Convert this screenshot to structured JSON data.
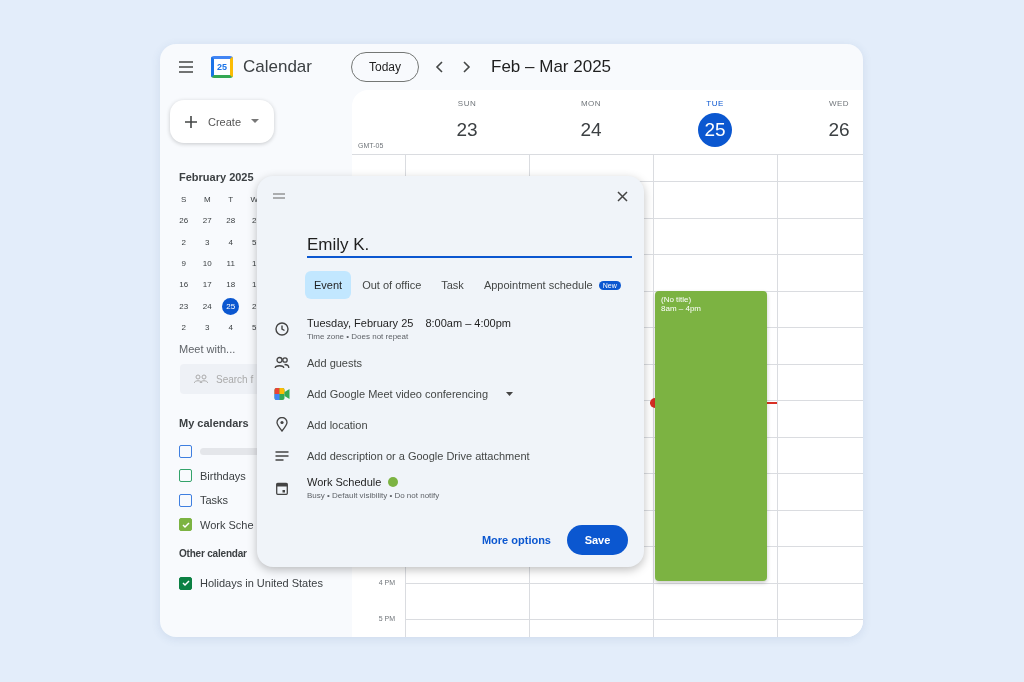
{
  "header": {
    "logo_text": "25",
    "app_name": "Calendar",
    "today_button": "Today",
    "date_range": "Feb – Mar 2025"
  },
  "sidebar": {
    "create_button": "Create",
    "mini_calendar": {
      "title": "February 2025",
      "weekdays": [
        "S",
        "M",
        "T",
        "W"
      ],
      "weeks": [
        [
          {
            "day": "26",
            "selected": false
          },
          {
            "day": "27",
            "selected": false
          },
          {
            "day": "28",
            "selected": false
          },
          {
            "day": "2",
            "selected": false
          }
        ],
        [
          {
            "day": "2",
            "selected": false
          },
          {
            "day": "3",
            "selected": false
          },
          {
            "day": "4",
            "selected": false
          },
          {
            "day": "5",
            "selected": false
          }
        ],
        [
          {
            "day": "9",
            "selected": false
          },
          {
            "day": "10",
            "selected": false
          },
          {
            "day": "11",
            "selected": false
          },
          {
            "day": "1",
            "selected": false
          }
        ],
        [
          {
            "day": "16",
            "selected": false
          },
          {
            "day": "17",
            "selected": false
          },
          {
            "day": "18",
            "selected": false
          },
          {
            "day": "1",
            "selected": false
          }
        ],
        [
          {
            "day": "23",
            "selected": false
          },
          {
            "day": "24",
            "selected": false
          },
          {
            "day": "25",
            "selected": true
          },
          {
            "day": "2",
            "selected": false
          }
        ],
        [
          {
            "day": "2",
            "selected": false
          },
          {
            "day": "3",
            "selected": false
          },
          {
            "day": "4",
            "selected": false
          },
          {
            "day": "5",
            "selected": false
          }
        ]
      ]
    },
    "meet_with": "Meet with...",
    "search": {
      "placeholder": "Search f"
    },
    "my_calendars": {
      "title": "My calendars",
      "items": [
        {
          "kind": "redacted",
          "checked": false,
          "color": "#3f7fe0"
        },
        {
          "kind": "named",
          "label": "Birthdays",
          "checked": false,
          "color": "#33a36a"
        },
        {
          "kind": "named",
          "label": "Tasks",
          "checked": false,
          "color": "#3f7fe0"
        },
        {
          "kind": "named",
          "label": "Work Sche",
          "checked": true,
          "color": "#7cb342"
        }
      ]
    },
    "other_calendars": {
      "title": "Other calendar",
      "items": [
        {
          "kind": "named",
          "label": "Holidays in United States",
          "checked": true,
          "color": "#0b8043"
        }
      ]
    }
  },
  "grid": {
    "timezone": "GMT-05",
    "days": [
      {
        "weekday": "SUN",
        "date": "23",
        "selected": false
      },
      {
        "weekday": "MON",
        "date": "24",
        "selected": false
      },
      {
        "weekday": "TUE",
        "date": "25",
        "selected": true
      },
      {
        "weekday": "WED",
        "date": "26",
        "selected": false
      }
    ],
    "time_labels": [
      "4 PM",
      "5 PM"
    ],
    "event": {
      "title": "(No title)",
      "time": "8am – 4pm",
      "color": "#7cb342"
    }
  },
  "dialog": {
    "title_value": "Emily K.",
    "tabs": [
      {
        "label": "Event",
        "selected": true
      },
      {
        "label": "Out of office",
        "selected": false
      },
      {
        "label": "Task",
        "selected": false
      },
      {
        "label": "Appointment schedule",
        "selected": false,
        "badge": "New"
      }
    ],
    "rows": [
      {
        "kind": "clock",
        "date": "Tuesday, February 25",
        "time": "8:00am  –  4:00pm",
        "secondary": "Time zone • Does not repeat"
      },
      {
        "kind": "guests",
        "primary": "Add guests"
      },
      {
        "kind": "meet",
        "primary": "Add Google Meet video conferencing",
        "dropdown": true
      },
      {
        "kind": "location",
        "primary": "Add location"
      },
      {
        "kind": "description",
        "primary": "Add description or a Google Drive attachment"
      },
      {
        "kind": "calendar",
        "primary": "Work Schedule",
        "color": "#7cb342",
        "secondary": "Busy • Default visibility • Do not notify"
      }
    ],
    "more_options": "More options",
    "save": "Save"
  }
}
